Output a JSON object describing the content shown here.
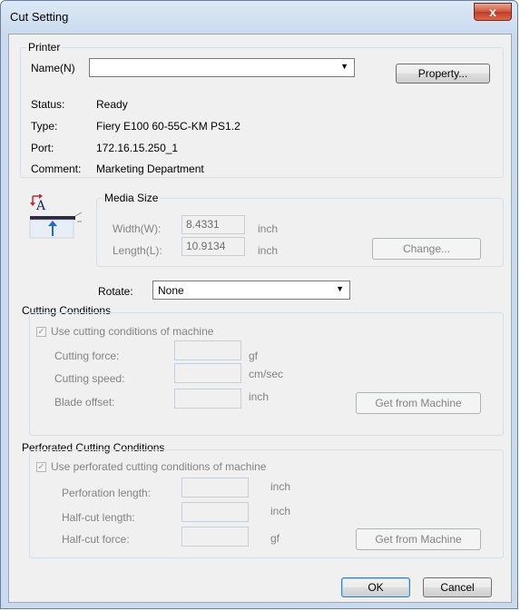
{
  "window": {
    "title": "Cut Setting",
    "close_glyph": "x"
  },
  "printer": {
    "group_label": "Printer",
    "name_label": "Name(N)",
    "name_value": "",
    "property_button": "Property...",
    "status_label": "Status:",
    "status_value": "Ready",
    "type_label": "Type:",
    "type_value": "Fiery E100 60-55C-KM PS1.2",
    "port_label": "Port:",
    "port_value": "172.16.15.250_1",
    "comment_label": "Comment:",
    "comment_value": "Marketing Department"
  },
  "media_size": {
    "icon": "media-orientation-icon",
    "group_label": "Media Size",
    "width_label": "Width(W):",
    "width_value": "8.4331",
    "width_unit": "inch",
    "length_label": "Length(L):",
    "length_value": "10.9134",
    "length_unit": "inch",
    "change_button": "Change..."
  },
  "rotate": {
    "label": "Rotate:",
    "value": "None"
  },
  "cutting": {
    "group_label": "Cutting Conditions",
    "use_machine_label": "Use cutting conditions of machine",
    "use_machine_checked": true,
    "force_label": "Cutting force:",
    "force_value": "",
    "force_unit": "gf",
    "speed_label": "Cutting speed:",
    "speed_value": "",
    "speed_unit": "cm/sec",
    "offset_label": "Blade offset:",
    "offset_value": "",
    "offset_unit": "inch",
    "get_button": "Get from Machine"
  },
  "perforated": {
    "group_label": "Perforated Cutting Conditions",
    "use_machine_label": "Use perforated cutting conditions of machine",
    "use_machine_checked": true,
    "perf_length_label": "Perforation length:",
    "perf_length_value": "",
    "perf_length_unit": "inch",
    "half_length_label": "Half-cut length:",
    "half_length_value": "",
    "half_length_unit": "inch",
    "half_force_label": "Half-cut force:",
    "half_force_value": "",
    "half_force_unit": "gf",
    "get_button": "Get from Machine"
  },
  "footer": {
    "ok_button": "OK",
    "cancel_button": "Cancel"
  }
}
